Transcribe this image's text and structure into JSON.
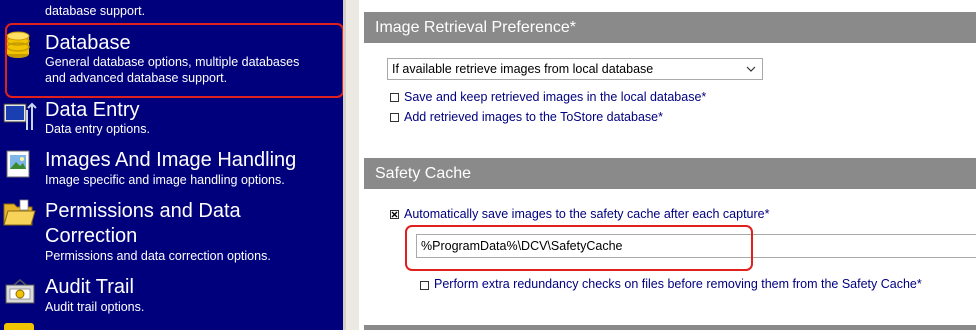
{
  "sidebar": {
    "items": [
      {
        "title": "",
        "description": "database support."
      },
      {
        "title": "Database",
        "description_lines": [
          "General database options, multiple databases",
          "and advanced database support."
        ]
      },
      {
        "title": "Data Entry",
        "description": "Data entry options."
      },
      {
        "title": "Images And Image Handling",
        "description": "Image specific and image handling options."
      },
      {
        "title_lines": [
          "Permissions and Data",
          "Correction"
        ],
        "description": "Permissions and data correction options."
      },
      {
        "title": "Audit Trail",
        "description": "Audit trail options."
      }
    ]
  },
  "image_retrieval": {
    "heading": "Image Retrieval Preference*",
    "select_value": "If available retrieve images from local database",
    "options": [
      {
        "label": "Save and keep retrieved images in the local database*",
        "checked": false
      },
      {
        "label": "Add retrieved images to the ToStore database*",
        "checked": false
      }
    ]
  },
  "safety_cache": {
    "heading": "Safety Cache",
    "auto_save_label": "Automatically save images to the safety cache after each capture*",
    "auto_save_checked": true,
    "path_value": "%ProgramData%\\DCV\\SafetyCache",
    "redundancy_label": "Perform extra redundancy checks on files before removing them from the Safety Cache*",
    "redundancy_checked": false
  },
  "colors": {
    "sidebar_bg": "#00007d",
    "section_header_bg": "#8a8a8a",
    "highlight_ring": "#e0201c",
    "option_text": "#000080"
  }
}
